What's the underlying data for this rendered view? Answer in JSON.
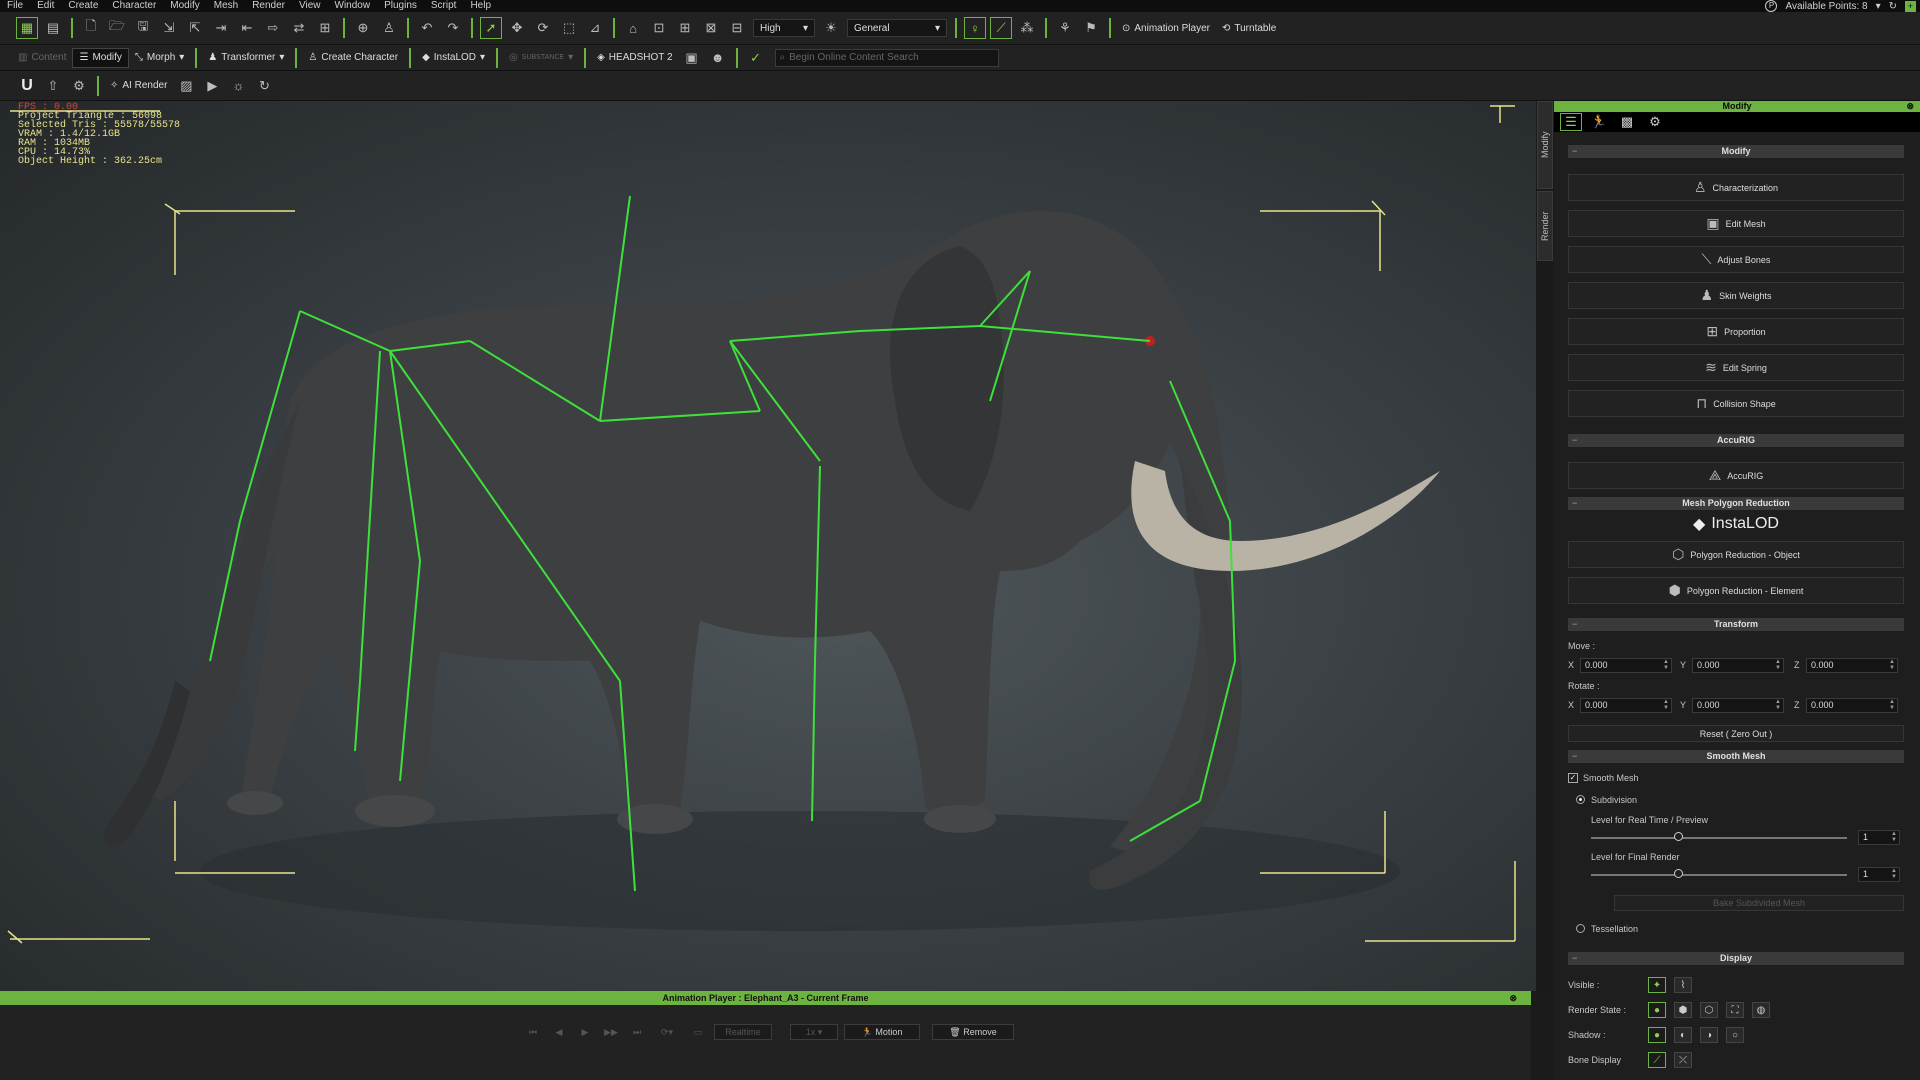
{
  "menu": [
    "File",
    "Edit",
    "Create",
    "Character",
    "Modify",
    "Mesh",
    "Render",
    "View",
    "Window",
    "Plugins",
    "Script",
    "Help"
  ],
  "points": {
    "label": "Available Points: 8"
  },
  "toolbar": {
    "quality": "High",
    "preset": "General",
    "animation_player": "Animation Player",
    "turntable": "Turntable",
    "content": "Content",
    "modify": "Modify",
    "morph": "Morph",
    "transformer": "Transformer",
    "create_character": "Create Character",
    "instalod": "InstaLOD",
    "substance": "SUBSTANCE",
    "headshot": "HEADSHOT 2",
    "search_placeholder": "Begin Online Content Search",
    "ai_render": "AI Render"
  },
  "stats": {
    "fps": "FPS : 0.00",
    "triangles": "Project Triangle : 56098",
    "selected": "Selected Tris : 55578/55578",
    "vram": "VRAM : 1.4/12.1GB",
    "ram": "RAM : 1034MB",
    "cpu": "CPU : 14.73%",
    "height": "Object Height : 362.25cm"
  },
  "side_tabs": {
    "modify": "Modify",
    "render": "Render"
  },
  "panel": {
    "title": "Modify",
    "sections": {
      "modify": "Modify",
      "accurig": "AccuRIG",
      "polyred": "Mesh Polygon Reduction",
      "transform": "Transform",
      "smooth": "Smooth Mesh",
      "display": "Display"
    },
    "buttons": {
      "characterization": "Characterization",
      "edit_mesh": "Edit Mesh",
      "adjust_bones": "Adjust Bones",
      "skin_weights": "Skin Weights",
      "proportion": "Proportion",
      "edit_spring": "Edit Spring",
      "collision_shape": "Collision Shape",
      "accurig": "AccuRIG",
      "instalod_logo": "InstaLOD",
      "poly_object": "Polygon Reduction - Object",
      "poly_element": "Polygon Reduction - Element",
      "reset": "Reset ( Zero Out )",
      "bake": "Bake Subdivided Mesh"
    },
    "transform": {
      "move_label": "Move :",
      "rotate_label": "Rotate :",
      "x": "X",
      "y": "Y",
      "z": "Z",
      "move": [
        "0.000",
        "0.000",
        "0.000"
      ],
      "rotate": [
        "0.000",
        "0.000",
        "0.000"
      ]
    },
    "smooth": {
      "smooth_mesh": "Smooth Mesh",
      "subdivision": "Subdivision",
      "realtime_label": "Level for Real Time / Preview",
      "realtime_value": "1",
      "final_label": "Level for Final Render",
      "final_value": "1",
      "tessellation": "Tessellation"
    },
    "display": {
      "visible": "Visible :",
      "render_state": "Render State :",
      "shadow": "Shadow :",
      "bone_display": "Bone Display"
    }
  },
  "anim": {
    "title": "Animation Player : Elephant_A3 - Current Frame",
    "realtime": "Realtime",
    "speed": "1x",
    "motion": "Motion",
    "remove": "Remove"
  },
  "colors": {
    "accent": "#6db33f",
    "bone": "#3ee03a",
    "stats": "#e8e38a"
  }
}
